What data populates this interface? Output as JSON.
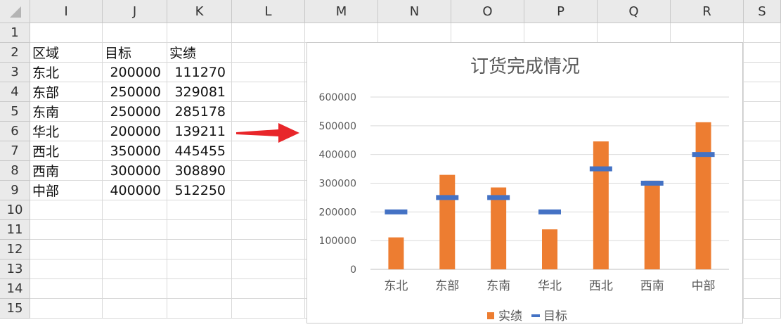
{
  "sheet": {
    "columns": [
      "I",
      "J",
      "K",
      "L",
      "M",
      "N",
      "O",
      "P",
      "Q",
      "R",
      "S"
    ],
    "rows": [
      "1",
      "2",
      "3",
      "4",
      "5",
      "6",
      "7",
      "8",
      "9",
      "10",
      "11",
      "12",
      "13",
      "14",
      "15"
    ],
    "table": {
      "headers": [
        "区域",
        "目标",
        "实绩"
      ],
      "rows": [
        [
          "东北",
          "200000",
          "111270"
        ],
        [
          "东部",
          "250000",
          "329081"
        ],
        [
          "东南",
          "250000",
          "285178"
        ],
        [
          "华北",
          "200000",
          "139211"
        ],
        [
          "西北",
          "350000",
          "445455"
        ],
        [
          "西南",
          "300000",
          "308890"
        ],
        [
          "中部",
          "400000",
          "512250"
        ]
      ]
    }
  },
  "arrow": {
    "color": "#e8262a"
  },
  "chart_data": {
    "type": "bar",
    "title": "订货完成情况",
    "categories": [
      "东北",
      "东部",
      "东南",
      "华北",
      "西北",
      "西南",
      "中部"
    ],
    "series": [
      {
        "name": "实绩",
        "kind": "bar",
        "color": "#ed7d31",
        "values": [
          111270,
          329081,
          285178,
          139211,
          445455,
          308890,
          512250
        ]
      },
      {
        "name": "目标",
        "kind": "marker",
        "color": "#4472c4",
        "values": [
          200000,
          250000,
          250000,
          200000,
          350000,
          300000,
          400000
        ]
      }
    ],
    "yticks": [
      "600000",
      "500000",
      "400000",
      "300000",
      "200000",
      "100000",
      "0"
    ],
    "ylim": [
      0,
      600000
    ],
    "grid": true,
    "legend_position": "bottom"
  }
}
